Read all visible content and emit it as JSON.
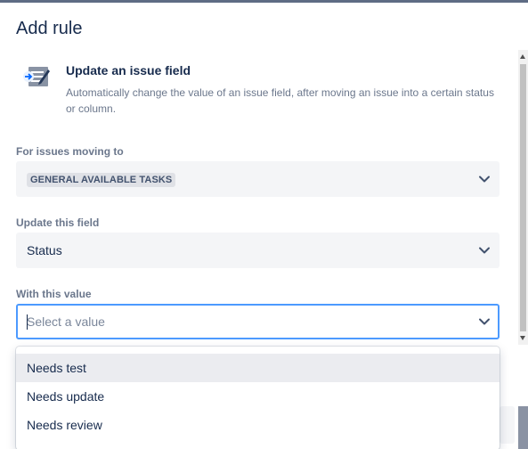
{
  "dialog": {
    "title": "Add rule"
  },
  "rule": {
    "icon": "update-field-icon",
    "name": "Update an issue field",
    "description": "Automatically change the value of an issue field, after moving an issue into a certain status or column."
  },
  "fields": {
    "moving_to": {
      "label": "For issues moving to",
      "value": "GENERAL AVAILABLE TASKS"
    },
    "update_field": {
      "label": "Update this field",
      "value": "Status"
    },
    "with_value": {
      "label": "With this value",
      "placeholder": "Select a value"
    }
  },
  "dropdown": {
    "options": [
      "Needs test",
      "Needs update",
      "Needs review"
    ],
    "highlighted_index": 0
  },
  "colors": {
    "text": "#172b4d",
    "subtle_text": "#6b778c",
    "field_bg": "#f4f5f7",
    "focus_border": "#4c9aff",
    "option_hover": "#ebecf0"
  }
}
